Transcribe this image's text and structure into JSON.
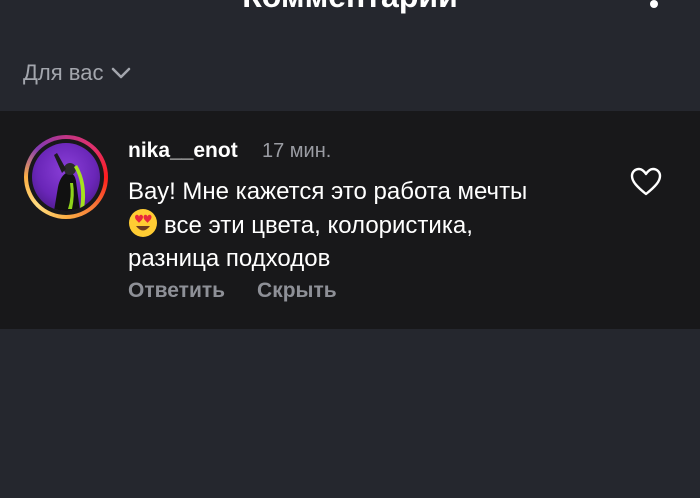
{
  "header": {
    "title": "Комментарии"
  },
  "filter": {
    "label": "Для вас",
    "icon": "chevron-down-icon"
  },
  "comment": {
    "username": "nika__enot",
    "time": "17 мин.",
    "text_line1": "Вау! Мне кажется это работа мечты",
    "text_line2": "все эти цвета, колористика,",
    "text_line3": "разница подходов",
    "emoji": "heart-eyes-emoji",
    "reply_label": "Ответить",
    "hide_label": "Скрыть",
    "like_icon": "heart-icon"
  },
  "colors": {
    "background": "#25272e",
    "comment_background": "#18181a",
    "muted_text": "#9a9ca3"
  }
}
